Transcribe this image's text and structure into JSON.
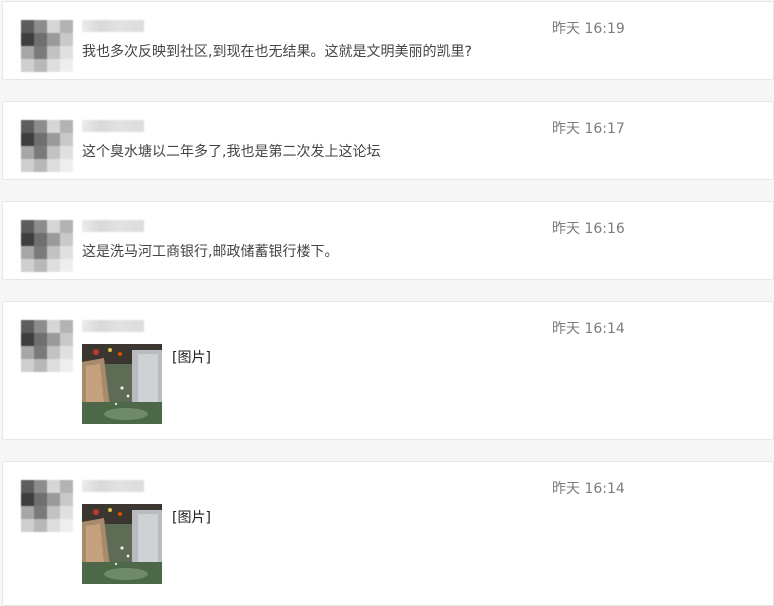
{
  "comments": [
    {
      "time": "昨天 16:19",
      "text": "我也多次反映到社区,到现在也无结果。这就是文明美丽的凯里?"
    },
    {
      "time": "昨天 16:17",
      "text": "这个臭水塘以二年多了,我也是第二次发上这论坛"
    },
    {
      "time": "昨天 16:16",
      "text": "这是洗马河工商银行,邮政储蓄银行楼下。"
    },
    {
      "time": "昨天 16:14",
      "image_label": "[图片]"
    },
    {
      "time": "昨天 16:14",
      "image_label": "[图片]"
    }
  ],
  "colors": {
    "background": "#f7f7f8",
    "card": "#ffffff",
    "border": "#e6e6e6",
    "timestamp": "#7c7c7c",
    "body_text": "#444444"
  },
  "icons": {
    "avatar": "blurred-avatar",
    "username": "blurred-username",
    "thumbnail": "photo-thumbnail"
  }
}
